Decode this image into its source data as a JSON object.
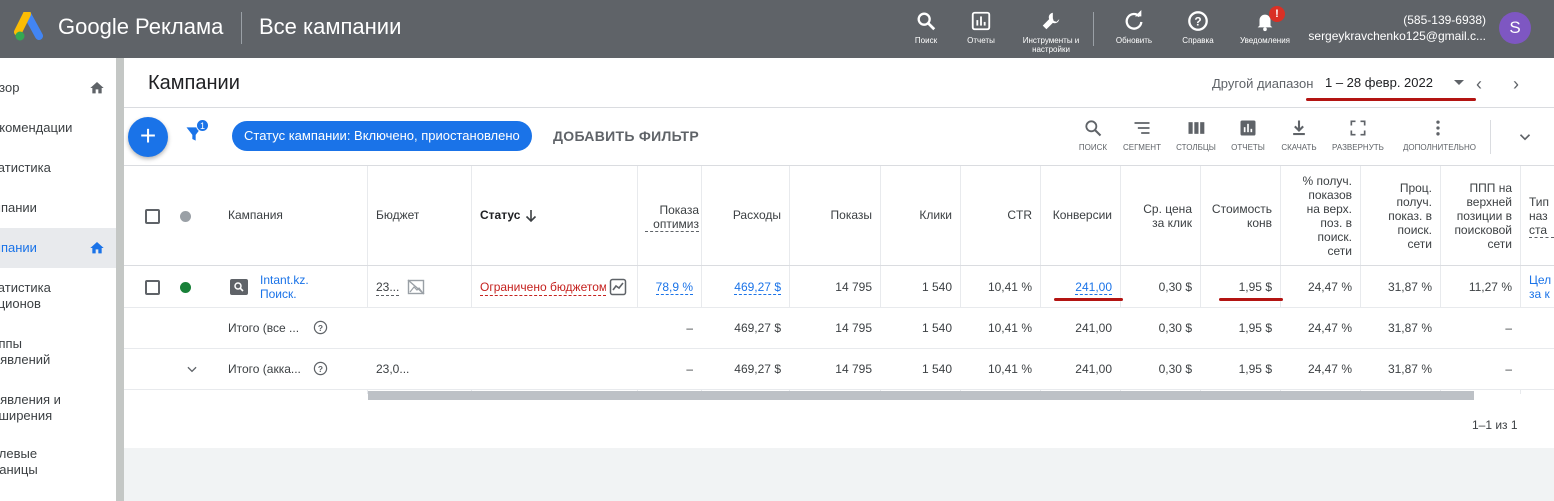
{
  "topbar": {
    "brand": "Google Реклама",
    "page_title": "Все кампании",
    "buttons": [
      {
        "label": "Поиск",
        "icon": "search-icon"
      },
      {
        "label": "Отчеты",
        "icon": "reports-icon"
      },
      {
        "label": "Инструменты и настройки",
        "icon": "wrench-icon"
      },
      {
        "label": "Обновить",
        "icon": "refresh-icon"
      },
      {
        "label": "Справка",
        "icon": "help-icon"
      },
      {
        "label": "Уведомления",
        "icon": "bell-icon"
      }
    ],
    "notification_badge": "!",
    "account_phone": "(585-139-6938)",
    "account_email": "sergeykravchenko125@gmail.c...",
    "avatar_letter": "S",
    "colors": {
      "bar": "#5f6368",
      "avatar": "#7e57c2"
    }
  },
  "sidebar": {
    "items": [
      {
        "label": "бзор",
        "home": true,
        "active": false
      },
      {
        "label": "екомендации",
        "home": false,
        "active": false
      },
      {
        "label": "татистика",
        "home": false,
        "active": false
      },
      {
        "label": "мпании",
        "home": false,
        "active": false
      },
      {
        "label": "мпании",
        "home": true,
        "active": true
      },
      {
        "label": "татистика\nкционов",
        "home": false,
        "active": false
      },
      {
        "label": "уппы\nъявлений",
        "home": false,
        "active": false
      },
      {
        "label": "ъявления и\nсширения",
        "home": false,
        "active": false
      },
      {
        "label": "елевые\nраницы",
        "home": false,
        "active": false
      }
    ]
  },
  "header": {
    "title": "Кампании",
    "range_label": "Другой диапазон",
    "range_value": "1 – 28 февр. 2022"
  },
  "filters": {
    "filter_badge": "1",
    "chip_label": "Статус кампании: Включено, приостановлено",
    "add_filter": "ДОБАВИТЬ ФИЛЬТР",
    "tools": [
      {
        "label": "ПОИСК",
        "icon": "search-icon"
      },
      {
        "label": "СЕГМЕНТ",
        "icon": "segment-icon"
      },
      {
        "label": "СТОЛБЦЫ",
        "icon": "columns-icon"
      },
      {
        "label": "ОТЧЕТЫ",
        "icon": "reports-icon"
      },
      {
        "label": "СКАЧАТЬ",
        "icon": "download-icon"
      },
      {
        "label": "РАЗВЕРНУТЬ",
        "icon": "fullscreen-icon"
      },
      {
        "label": "ДОПОЛНИТЕЛЬНО",
        "icon": "more-icon"
      }
    ]
  },
  "table": {
    "headers": {
      "campaign": "Кампания",
      "budget": "Бюджет",
      "status": "Статус",
      "optim": [
        "Показа",
        "оптимиз"
      ],
      "cost": "Расходы",
      "impr": "Показы",
      "clicks": "Клики",
      "ctr": "CTR",
      "conv": "Конверсии",
      "cpc": [
        "Ср. цена",
        "за клик"
      ],
      "cpconv": [
        "Стоимость",
        "конв"
      ],
      "top_is": [
        "% получ.",
        "показов",
        "на верх.",
        "поз. в",
        "поиск.",
        "сети"
      ],
      "is": [
        "Проц.",
        "получ.",
        "показ. в",
        "поиск.",
        "сети"
      ],
      "top_ppp": [
        "ППП на",
        "верхней",
        "позиции в",
        "поисковой",
        "сети"
      ],
      "type": [
        "Тип",
        "наз",
        "ста"
      ]
    },
    "campaign_row": {
      "name": [
        "Intant.kz.",
        "Поиск."
      ],
      "budget": "23...",
      "status": "Ограничено бюджетом",
      "optim": "78,9 %",
      "cost": "469,27 $",
      "impr": "14 795",
      "clicks": "1 540",
      "ctr": "10,41 %",
      "conv": "241,00",
      "cpc": "0,30 $",
      "cpconv": "1,95 $",
      "top_is": "24,47 %",
      "is": "31,87 %",
      "top_ppp": "11,27 %",
      "type": [
        "Цел",
        "за к"
      ]
    },
    "total_rows": [
      {
        "name": "Итого (все ...",
        "budget": "",
        "optim": "–",
        "cost": "469,27 $",
        "impr": "14 795",
        "clicks": "1 540",
        "ctr": "10,41 %",
        "conv": "241,00",
        "cpc": "0,30 $",
        "cpconv": "1,95 $",
        "top_is": "24,47 %",
        "is": "31,87 %",
        "top_ppp": "–"
      },
      {
        "name": "Итого (акка...",
        "budget": "23,0...",
        "optim": "–",
        "cost": "469,27 $",
        "impr": "14 795",
        "clicks": "1 540",
        "ctr": "10,41 %",
        "conv": "241,00",
        "cpc": "0,30 $",
        "cpconv": "1,95 $",
        "top_is": "24,47 %",
        "is": "31,87 %",
        "top_ppp": "–"
      }
    ]
  },
  "pager": "1–1 из 1",
  "colors": {
    "accent": "#1a73e8",
    "annotation": "#b31412",
    "status_limited": "#c5221f",
    "enabled_dot": "#188038"
  }
}
